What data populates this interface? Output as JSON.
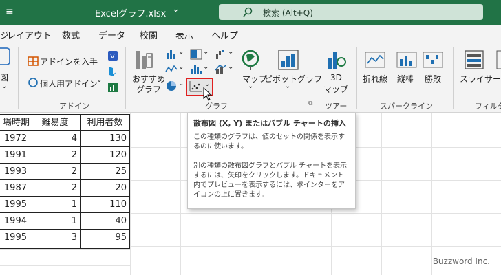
{
  "title_bar": {
    "file_name": "Excelグラフ.xlsx",
    "dropdown_glyph": "⌄",
    "search_label": "検索 (Alt+Q)"
  },
  "menu": [
    "ジ",
    "レイアウト",
    "数式",
    "データ",
    "校閲",
    "表示",
    "ヘルプ"
  ],
  "ribbon": {
    "addin_get": "アドインを入手",
    "addin_personal": "個人用アドイン",
    "group_addin": "アドイン",
    "recommended_chart_1": "おすすめ",
    "recommended_chart_2": "グラフ",
    "map": "マップ",
    "pivot_chart": "ピボットグラフ",
    "group_chart": "グラフ",
    "map3d_1": "3D",
    "map3d_2": "マップ",
    "group_tour": "ツアー",
    "spark_line": "折れ線",
    "spark_column": "縦棒",
    "spark_winloss": "勝敗",
    "group_sparkline": "スパークライン",
    "slicer": "スライサー",
    "group_filter": "フィルター",
    "left_cut_label": "図"
  },
  "table": {
    "headers": [
      "場時期",
      "難易度",
      "利用者数"
    ],
    "rows": [
      [
        "1972",
        "4",
        "130"
      ],
      [
        "1991",
        "2",
        "120"
      ],
      [
        "1993",
        "2",
        "25"
      ],
      [
        "1987",
        "2",
        "20"
      ],
      [
        "1995",
        "1",
        "110"
      ],
      [
        "1994",
        "1",
        "40"
      ],
      [
        "1995",
        "3",
        "95"
      ]
    ]
  },
  "tooltip": {
    "title": "散布図 (X, Y) またはバブル チャートの挿入",
    "para1": "この種類のグラフは、値のセットの関係を表示するのに使います。",
    "para2": "別の種類の散布図グラフとバブル チャートを表示するには、矢印をクリックします。ドキュメント内でプレビューを表示するには、ポインターをアイコンの上に置きます。"
  },
  "watermark": "Buzzword Inc.",
  "colors": {
    "title_bar": "#217346",
    "ribbon_bg": "#f3f3f3",
    "highlight_border": "#e02020"
  }
}
